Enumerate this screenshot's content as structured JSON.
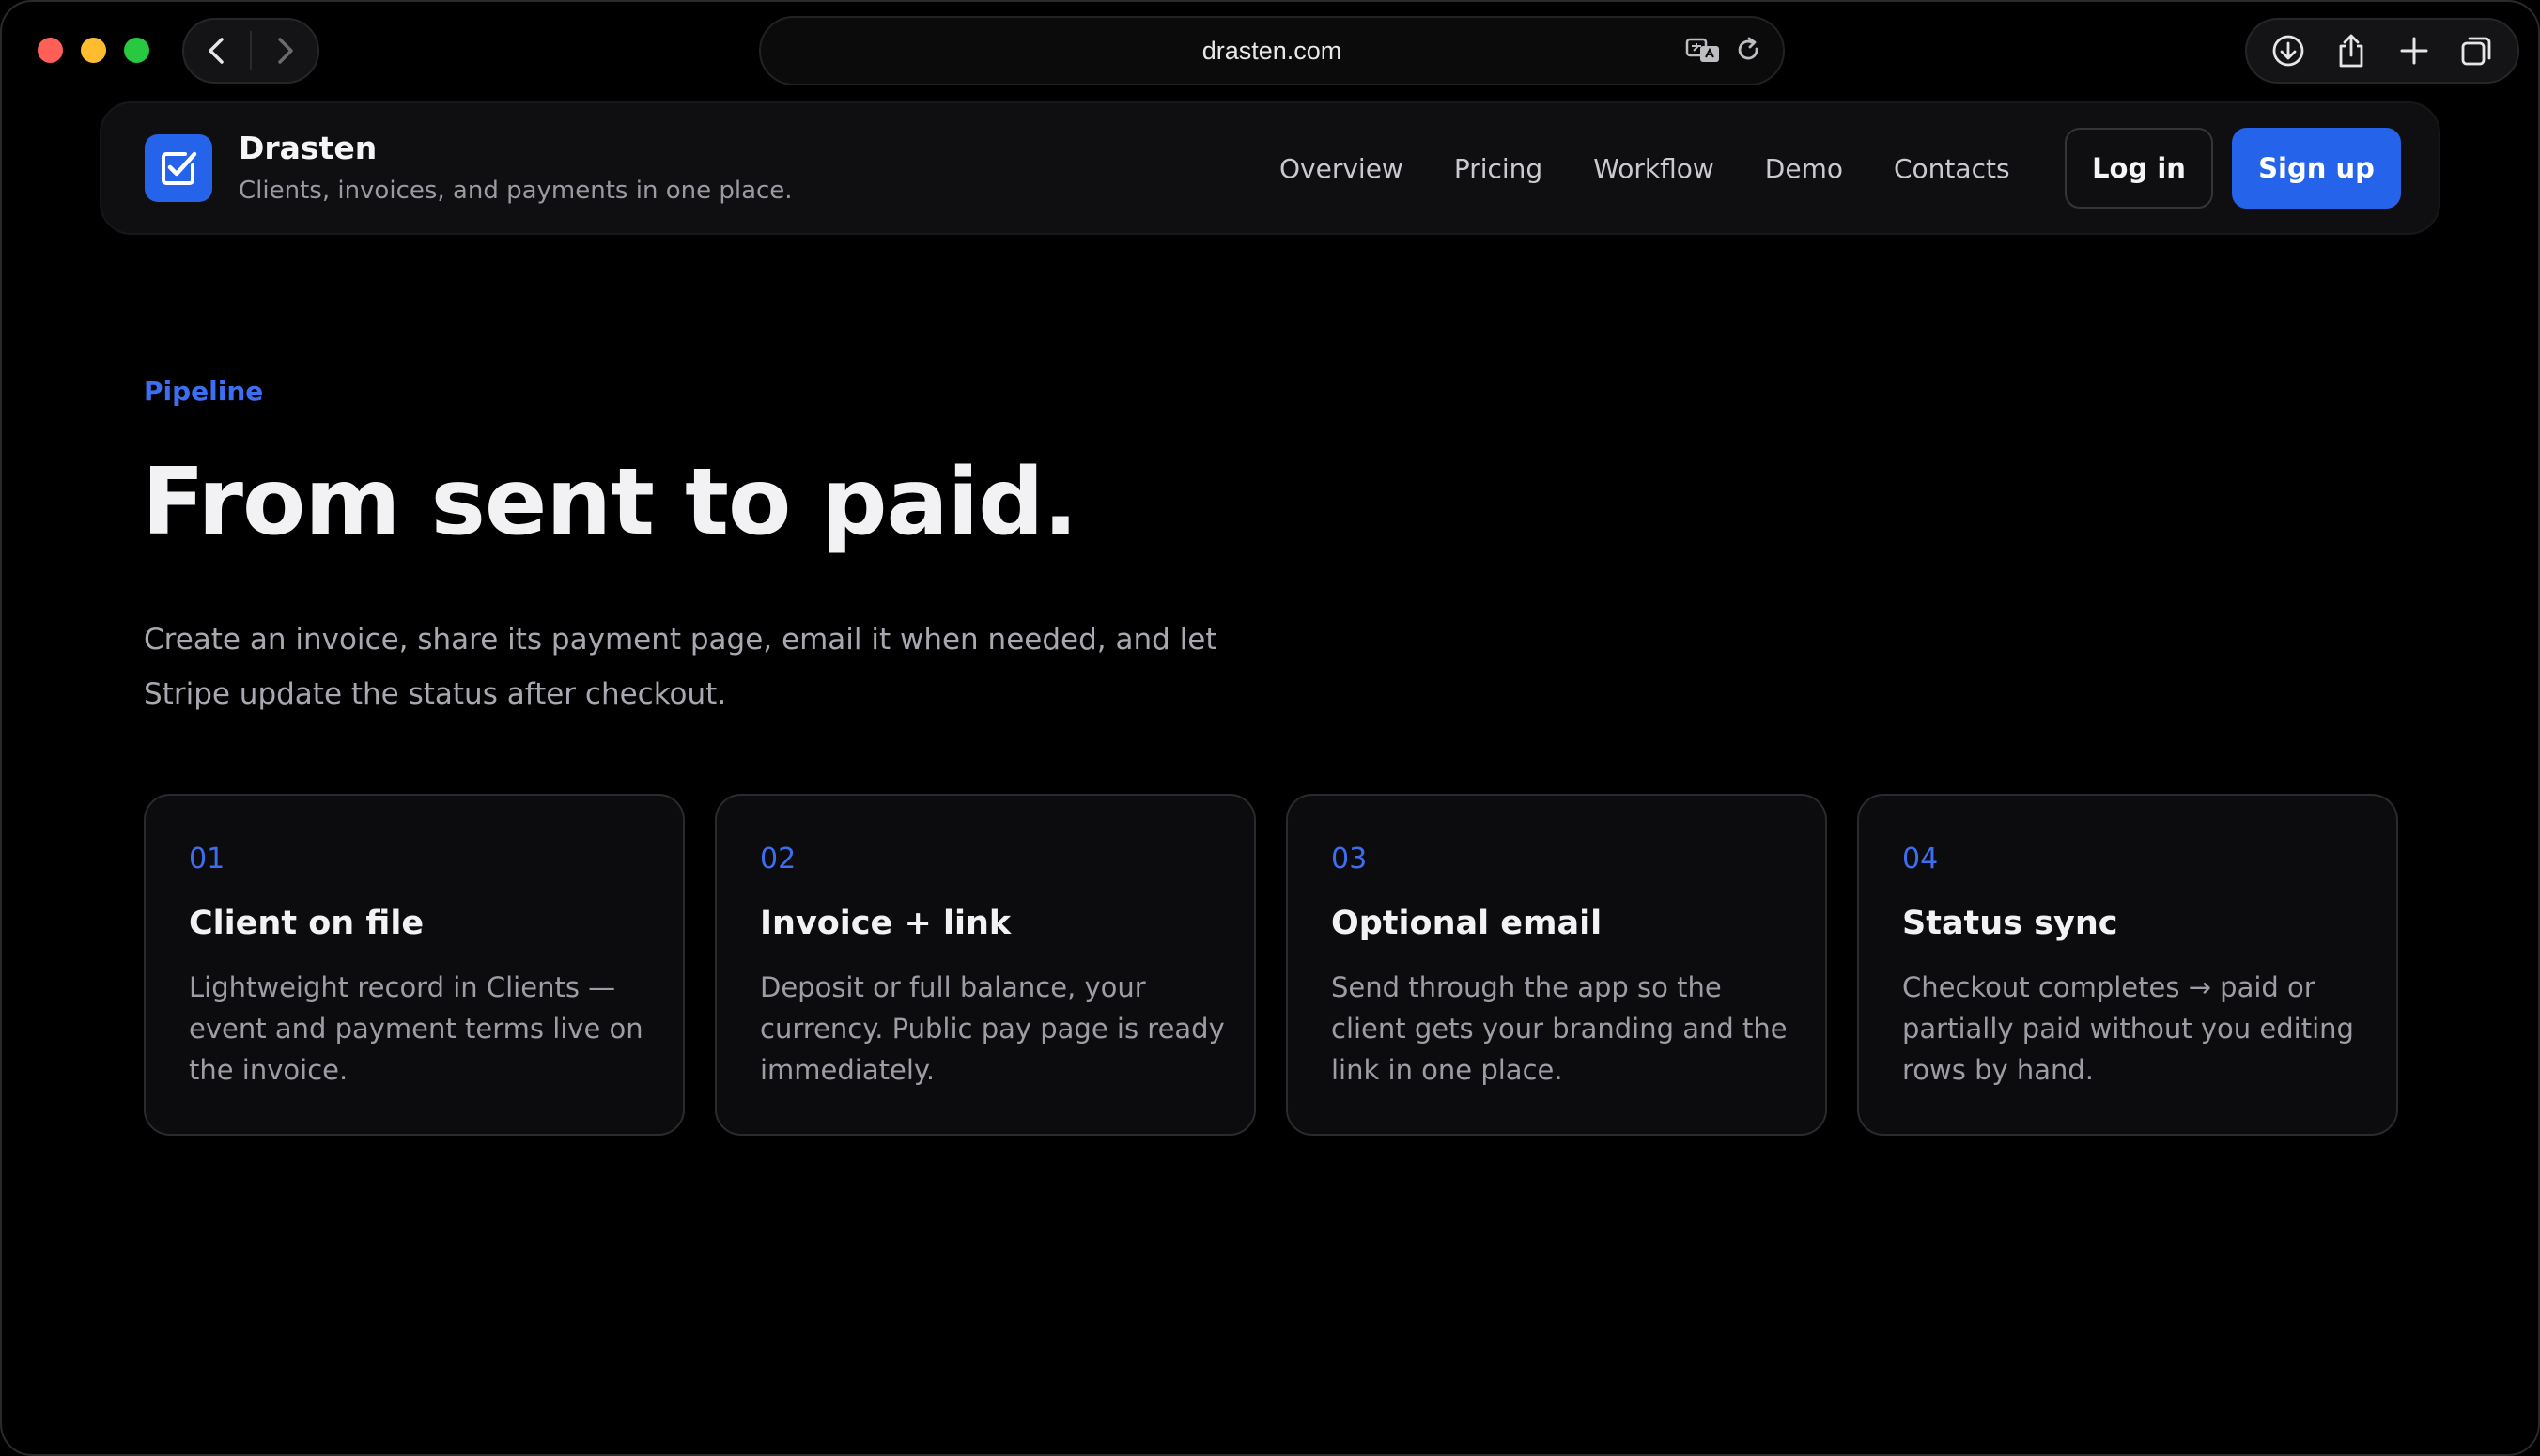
{
  "browser": {
    "url": "drasten.com"
  },
  "header": {
    "brand_name": "Drasten",
    "tagline": "Clients, invoices, and payments in one place.",
    "nav": [
      "Overview",
      "Pricing",
      "Workflow",
      "Demo",
      "Contacts"
    ],
    "login_label": "Log in",
    "signup_label": "Sign up"
  },
  "hero": {
    "eyebrow": "Pipeline",
    "title": "From sent to paid.",
    "lead": "Create an invoice, share its payment page, email it when needed, and let Stripe update the status after checkout."
  },
  "steps": [
    {
      "number": "01",
      "title": "Client on file",
      "text": "Lightweight record in Clients — event and payment terms live on the invoice."
    },
    {
      "number": "02",
      "title": "Invoice + link",
      "text": "Deposit or full balance, your currency. Public pay page is ready immediately."
    },
    {
      "number": "03",
      "title": "Optional email",
      "text": "Send through the app so the client gets your branding and the link in one place."
    },
    {
      "number": "04",
      "title": "Status sync",
      "text": "Checkout completes → paid or partially paid without you editing rows by hand."
    }
  ],
  "colors": {
    "accent": "#2563eb",
    "accent_text": "#3b6ef0",
    "background": "#000000"
  },
  "icons": {
    "back": "chevron-left-icon",
    "forward": "chevron-right-icon",
    "translate": "translate-icon",
    "reload": "reload-icon",
    "download": "download-icon",
    "share": "share-icon",
    "new_tab": "plus-icon",
    "tabs": "tabs-overview-icon",
    "logo": "checkbox-edit-icon"
  }
}
